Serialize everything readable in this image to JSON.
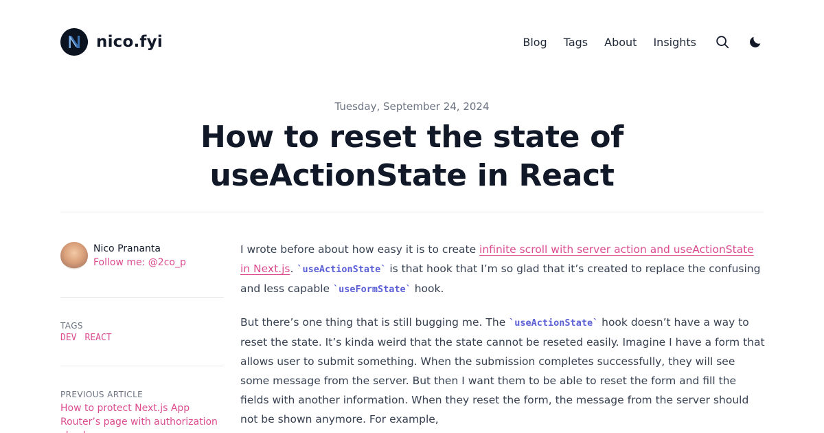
{
  "header": {
    "brand": "nico.fyi",
    "nav": [
      "Blog",
      "Tags",
      "About",
      "Insights"
    ],
    "icons": [
      "search-icon",
      "moon-icon"
    ]
  },
  "post": {
    "date": "Tuesday, September 24, 2024",
    "title": "How to reset the state of useActionState in React"
  },
  "sidebar": {
    "author_name": "Nico Prananta",
    "author_follow": "Follow me: @2co_p",
    "tags_label": "TAGS",
    "tags": [
      "DEV",
      "REACT"
    ],
    "prev_label": "PREVIOUS ARTICLE",
    "prev_title": "How to protect Next.js App Router’s page with authorization check"
  },
  "article": {
    "p1": {
      "t1": "I wrote before about how easy it is to create ",
      "link": "infinite scroll with server action and useActionState in Next.js",
      "t2": ". ",
      "code1": "`useActionState`",
      "t3": " is that hook that I’m so glad that it’s created to replace the confusing and less capable ",
      "code2": "`useFormState`",
      "t4": " hook."
    },
    "p2": {
      "t1": "But there’s one thing that is still bugging me. The ",
      "code1": "`useActionState`",
      "t2": " hook doesn’t have a way to reset the state. It’s kinda weird that the state cannot be reseted easily. Imagine I have a form that allows user to submit something. When the submission completes successfully, they will see some message from the server. But then I want them to be able to reset the form and fill the fields with another information. When they reset the form, the message from the server should not be shown anymore. For example,"
    }
  },
  "colors": {
    "accent": "#db4c8f",
    "code": "#5b5fd6",
    "text": "#374151",
    "heading": "#111827"
  }
}
